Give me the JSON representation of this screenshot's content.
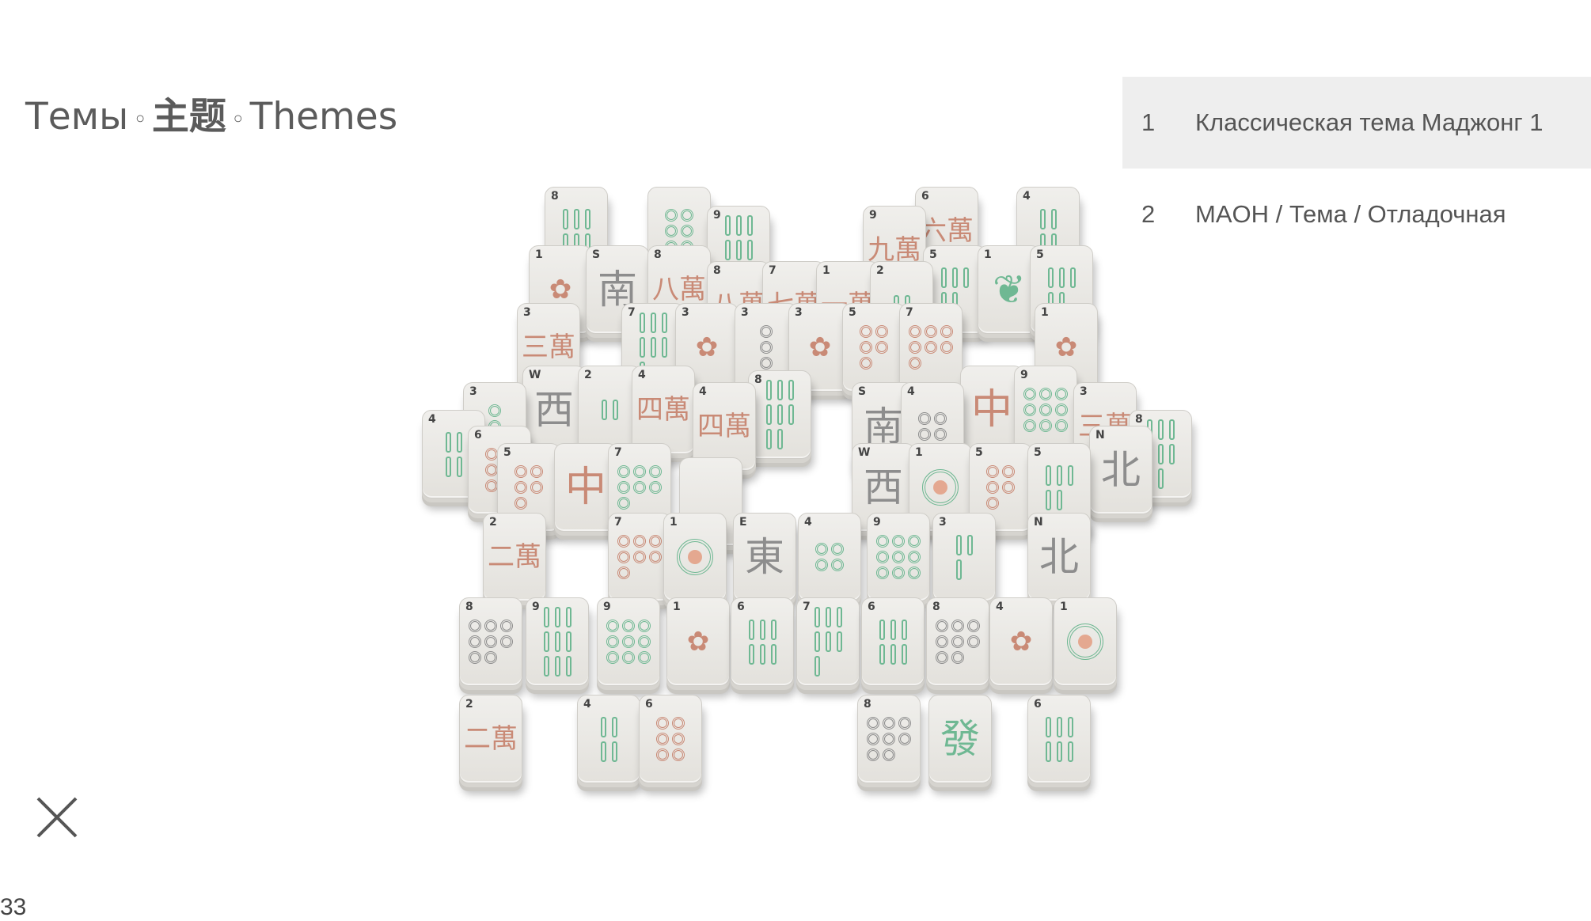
{
  "header": {
    "title_ru": "Темы",
    "title_zh": "主题",
    "title_en": "Themes",
    "separator": "◦"
  },
  "themes": [
    {
      "number": "1",
      "name": "Классическая тема Маджонг 1",
      "selected": true
    },
    {
      "number": "2",
      "name": "MAOH / Тема / Отладочная",
      "selected": false
    }
  ],
  "footer": {
    "counter": "33"
  },
  "board": {
    "tiles": [
      {
        "kind": "bamboo",
        "corner": "8",
        "count": 6,
        "color": "g"
      },
      {
        "kind": "dots",
        "corner": "",
        "count": 6,
        "color": "g"
      },
      {
        "kind": "bamboo",
        "corner": "9",
        "count": 9,
        "color": "g"
      },
      {
        "kind": "char",
        "corner": "9",
        "glyph": "九萬",
        "style": "cjk-red"
      },
      {
        "kind": "char",
        "corner": "6",
        "glyph": "六萬",
        "style": "cjk-red"
      },
      {
        "kind": "bamboo",
        "corner": "4",
        "count": 4,
        "color": "g"
      },
      {
        "kind": "flower",
        "corner": "1",
        "glyph": "✿",
        "style": "cjk-red"
      },
      {
        "kind": "wind",
        "corner": "S",
        "glyph": "南",
        "style": "cjk-gray"
      },
      {
        "kind": "char",
        "corner": "8",
        "glyph": "八萬",
        "style": "cjk-red"
      },
      {
        "kind": "char",
        "corner": "8",
        "glyph": "八萬",
        "style": "cjk-red"
      },
      {
        "kind": "char",
        "corner": "7",
        "glyph": "七萬",
        "style": "cjk-red"
      },
      {
        "kind": "char",
        "corner": "1",
        "glyph": "一萬",
        "style": "cjk-red"
      },
      {
        "kind": "bamboo",
        "corner": "2",
        "count": 2,
        "color": "g"
      },
      {
        "kind": "bamboo",
        "corner": "5",
        "count": 5,
        "color": "g"
      },
      {
        "kind": "flower",
        "corner": "1",
        "glyph": "❦",
        "style": "cjk-green"
      },
      {
        "kind": "bamboo",
        "corner": "5",
        "count": 5,
        "color": "g"
      },
      {
        "kind": "char",
        "corner": "3",
        "glyph": "三萬",
        "style": "cjk-red"
      },
      {
        "kind": "bamboo",
        "corner": "7",
        "count": 7,
        "color": "g"
      },
      {
        "kind": "flower",
        "corner": "3",
        "glyph": "✿",
        "style": "cjk-red"
      },
      {
        "kind": "dots",
        "corner": "3",
        "count": 3,
        "color": "k"
      },
      {
        "kind": "flower",
        "corner": "3",
        "glyph": "✿",
        "style": "cjk-red"
      },
      {
        "kind": "dots",
        "corner": "5",
        "count": 5,
        "color": "r"
      },
      {
        "kind": "dots",
        "corner": "7",
        "count": 7,
        "color": "r"
      },
      {
        "kind": "flower",
        "corner": "1",
        "glyph": "✿",
        "style": "cjk-red"
      },
      {
        "kind": "dots",
        "corner": "3",
        "count": 3,
        "color": "g"
      },
      {
        "kind": "bamboo",
        "corner": "4",
        "count": 4,
        "color": "g"
      },
      {
        "kind": "wind",
        "corner": "W",
        "glyph": "西",
        "style": "cjk-gray"
      },
      {
        "kind": "bamboo",
        "corner": "2",
        "count": 2,
        "color": "g"
      },
      {
        "kind": "char",
        "corner": "4",
        "glyph": "四萬",
        "style": "cjk-red"
      },
      {
        "kind": "char",
        "corner": "4",
        "glyph": "四萬",
        "style": "cjk-red"
      },
      {
        "kind": "bamboo",
        "corner": "8",
        "count": 8,
        "color": "g"
      },
      {
        "kind": "wind",
        "corner": "S",
        "glyph": "南",
        "style": "cjk-gray"
      },
      {
        "kind": "dots",
        "corner": "4",
        "count": 4,
        "color": "k"
      },
      {
        "kind": "dragon",
        "corner": "",
        "glyph": "中",
        "style": "cjk-redbig"
      },
      {
        "kind": "dots",
        "corner": "9",
        "count": 9,
        "color": "g"
      },
      {
        "kind": "char",
        "corner": "3",
        "glyph": "三萬",
        "style": "cjk-red"
      },
      {
        "kind": "bamboo",
        "corner": "8",
        "count": 8,
        "color": "g"
      },
      {
        "kind": "dots",
        "corner": "6",
        "count": 6,
        "color": "r"
      },
      {
        "kind": "dots",
        "corner": "5",
        "count": 5,
        "color": "r"
      },
      {
        "kind": "dragon",
        "corner": "",
        "glyph": "中",
        "style": "cjk-redbig"
      },
      {
        "kind": "dots",
        "corner": "7",
        "count": 7,
        "color": "g"
      },
      {
        "kind": "blank",
        "corner": "",
        "glyph": "",
        "style": ""
      },
      {
        "kind": "wind",
        "corner": "W",
        "glyph": "西",
        "style": "cjk-gray"
      },
      {
        "kind": "circle",
        "corner": "1",
        "glyph": "",
        "style": ""
      },
      {
        "kind": "dots",
        "corner": "5",
        "count": 5,
        "color": "r"
      },
      {
        "kind": "bamboo",
        "corner": "5",
        "count": 5,
        "color": "g"
      },
      {
        "kind": "wind",
        "corner": "N",
        "glyph": "北",
        "style": "cjk-gray"
      },
      {
        "kind": "char",
        "corner": "2",
        "glyph": "二萬",
        "style": "cjk-red"
      },
      {
        "kind": "dots",
        "corner": "7",
        "count": 7,
        "color": "r"
      },
      {
        "kind": "circle",
        "corner": "1",
        "glyph": "",
        "style": ""
      },
      {
        "kind": "wind",
        "corner": "E",
        "glyph": "東",
        "style": "cjk-gray"
      },
      {
        "kind": "dots",
        "corner": "4",
        "count": 4,
        "color": "g"
      },
      {
        "kind": "dots",
        "corner": "9",
        "count": 9,
        "color": "g"
      },
      {
        "kind": "bamboo",
        "corner": "3",
        "count": 3,
        "color": "g"
      },
      {
        "kind": "wind",
        "corner": "N",
        "glyph": "北",
        "style": "cjk-gray"
      },
      {
        "kind": "dots",
        "corner": "8",
        "count": 8,
        "color": "k"
      },
      {
        "kind": "bamboo",
        "corner": "9",
        "count": 9,
        "color": "g"
      },
      {
        "kind": "dots",
        "corner": "9",
        "count": 9,
        "color": "g"
      },
      {
        "kind": "flower",
        "corner": "1",
        "glyph": "✿",
        "style": "cjk-red"
      },
      {
        "kind": "bamboo",
        "corner": "6",
        "count": 6,
        "color": "g"
      },
      {
        "kind": "bamboo",
        "corner": "7",
        "count": 7,
        "color": "g"
      },
      {
        "kind": "bamboo",
        "corner": "6",
        "count": 6,
        "color": "g"
      },
      {
        "kind": "dots",
        "corner": "8",
        "count": 8,
        "color": "k"
      },
      {
        "kind": "flower",
        "corner": "4",
        "glyph": "✿",
        "style": "cjk-red"
      },
      {
        "kind": "circle",
        "corner": "1",
        "glyph": "",
        "style": ""
      },
      {
        "kind": "char",
        "corner": "2",
        "glyph": "二萬",
        "style": "cjk-red"
      },
      {
        "kind": "bamboo",
        "corner": "4",
        "count": 4,
        "color": "g"
      },
      {
        "kind": "dots",
        "corner": "6",
        "count": 6,
        "color": "r"
      },
      {
        "kind": "dots",
        "corner": "8",
        "count": 8,
        "color": "k"
      },
      {
        "kind": "dragon",
        "corner": "",
        "glyph": "發",
        "style": "cjk-green"
      },
      {
        "kind": "bamboo",
        "corner": "6",
        "count": 6,
        "color": "g"
      }
    ]
  }
}
